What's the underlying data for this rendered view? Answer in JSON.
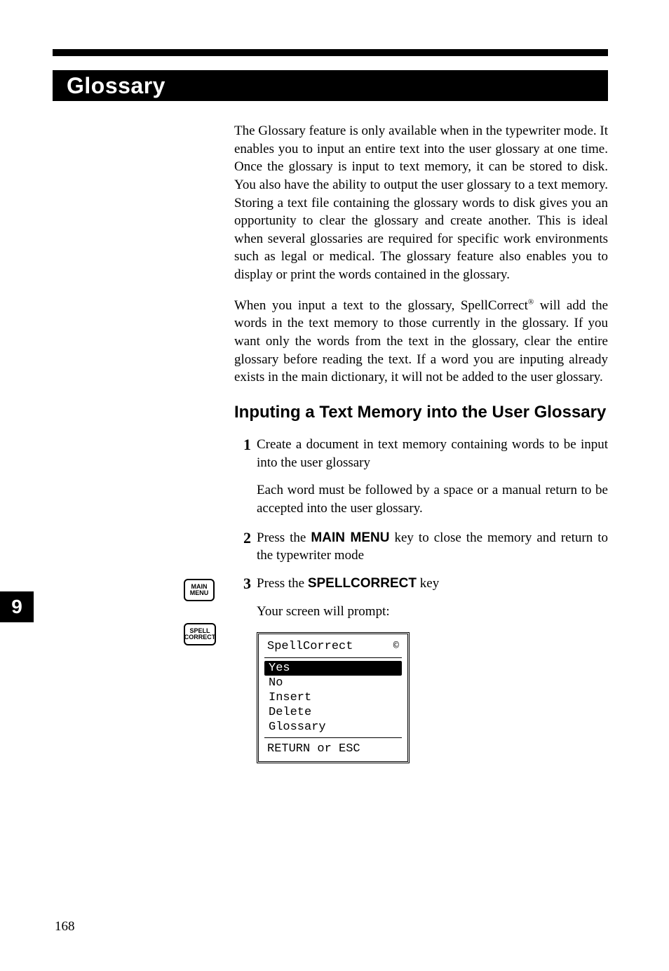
{
  "title": "Glossary",
  "side_tab": "9",
  "page_number": "168",
  "keys": {
    "main_menu": {
      "l1": "MAIN",
      "l2": "MENU"
    },
    "spell": {
      "l1": "SPELL",
      "l2": "CORRECT"
    }
  },
  "paragraphs": {
    "p1": "The Glossary feature is only available when in the typewriter mode. It enables you to input an entire text into the user glossary at one time. Once the glossary is input to text memory, it can be stored to disk. You also have the ability to output the user glossary to a text memory. Storing a text file containing the glossary words to disk gives you an opportunity to clear the glossary and create another. This is ideal when several glossaries are required for specific work environments such as legal or medical. The glossary feature also enables you to display or print the words contained in the glossary.",
    "p2_pre": "When you input a text to the glossary, SpellCorrect",
    "p2_post": " will add the words in the text memory to those currently in the glossary. If you want only the words from the text in the glossary, clear the entire glossary before reading the text. If a word you are inputing already exists in the main dictionary, it will not be added to the user glossary."
  },
  "section_heading": "Inputing a Text Memory into the User Glossary",
  "steps": {
    "s1": {
      "num": "1",
      "text": "Create a document in text memory containing words to be input into the user glossary",
      "sub": "Each word must be followed by a space or a manual return to be accepted into the user glossary."
    },
    "s2": {
      "num": "2",
      "pre": "Press the ",
      "bold": "MAIN MENU",
      "post": " key to close the memory and return to the typewriter mode"
    },
    "s3": {
      "num": "3",
      "pre": "Press the ",
      "bold": "SPELLCORRECT",
      "post": " key",
      "sub": "Your screen will prompt:"
    }
  },
  "menu": {
    "title": "SpellCorrect",
    "copyright": "©",
    "items": [
      "Yes",
      "No",
      "Insert",
      "Delete",
      "Glossary"
    ],
    "selected_index": 0,
    "footer": "RETURN or ESC"
  }
}
